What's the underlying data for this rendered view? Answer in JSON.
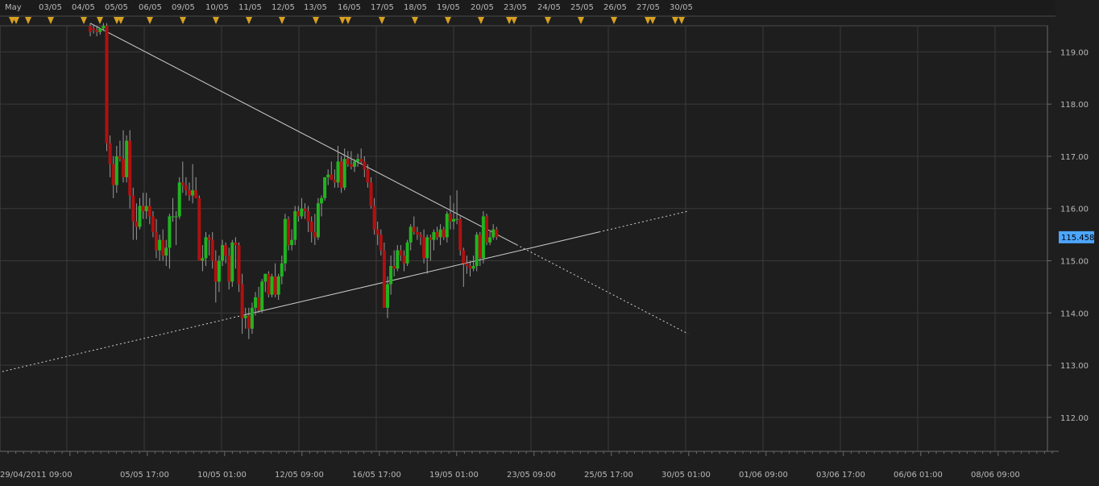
{
  "chart_data": {
    "type": "candlestick",
    "instrument_price_label": "115.458",
    "y_axis": {
      "ylim": [
        111.35,
        119.5
      ],
      "ticks": [
        112,
        113,
        114,
        115,
        116,
        117,
        118,
        119
      ],
      "tick_labels": [
        "112.00",
        "113.00",
        "114.00",
        "115.00",
        "116.00",
        "117.00",
        "118.00",
        "119.00"
      ]
    },
    "x_axis_bottom_labels": [
      "29/04/2011 09:00",
      "05/05 17:00",
      "10/05 01:00",
      "12/05 09:00",
      "16/05 17:00",
      "19/05 01:00",
      "23/05 09:00",
      "25/05 17:00",
      "30/05 01:00",
      "01/06 09:00",
      "03/06 17:00",
      "06/06 01:00",
      "08/06 09:00"
    ],
    "x_axis_top_labels": [
      "May",
      "03/05",
      "04/05",
      "05/05",
      "06/05",
      "09/05",
      "10/05",
      "11/05",
      "12/05",
      "13/05",
      "16/05",
      "17/05",
      "18/05",
      "19/05",
      "20/05",
      "23/05",
      "24/05",
      "25/05",
      "26/05",
      "27/05",
      "30/05"
    ],
    "grid": true,
    "colors": {
      "background": "#1e1e1e",
      "grid": "#3a3a3a",
      "bull": "#1fb51f",
      "bear": "#b01010",
      "wick": "#9a9a9a",
      "trendline": "#d0d0d0",
      "event_marker": "#d8a020",
      "price_tag": "#4da6ff"
    },
    "candles": [
      {
        "o": 119.5,
        "h": 119.55,
        "l": 119.3,
        "c": 119.38
      },
      {
        "o": 119.45,
        "h": 119.5,
        "l": 119.35,
        "c": 119.42
      },
      {
        "o": 119.42,
        "h": 119.5,
        "l": 119.3,
        "c": 119.38
      },
      {
        "o": 119.38,
        "h": 119.45,
        "l": 119.33,
        "c": 119.45
      },
      {
        "o": 119.45,
        "h": 119.55,
        "l": 119.4,
        "c": 119.5
      },
      {
        "o": 119.5,
        "h": 119.55,
        "l": 117.1,
        "c": 117.25
      },
      {
        "o": 117.25,
        "h": 117.4,
        "l": 116.6,
        "c": 116.85
      },
      {
        "o": 116.85,
        "h": 117.0,
        "l": 116.2,
        "c": 116.45
      },
      {
        "o": 116.45,
        "h": 117.2,
        "l": 116.3,
        "c": 117.0
      },
      {
        "o": 117.0,
        "h": 117.3,
        "l": 116.9,
        "c": 116.95
      },
      {
        "o": 116.95,
        "h": 117.5,
        "l": 116.5,
        "c": 116.6
      },
      {
        "o": 116.6,
        "h": 117.4,
        "l": 116.5,
        "c": 117.3
      },
      {
        "o": 117.3,
        "h": 117.5,
        "l": 116.0,
        "c": 116.25
      },
      {
        "o": 116.25,
        "h": 116.4,
        "l": 115.4,
        "c": 115.75
      },
      {
        "o": 115.75,
        "h": 116.1,
        "l": 115.4,
        "c": 115.65
      },
      {
        "o": 115.65,
        "h": 116.2,
        "l": 115.6,
        "c": 116.05
      },
      {
        "o": 116.05,
        "h": 116.3,
        "l": 115.8,
        "c": 115.95
      },
      {
        "o": 115.95,
        "h": 116.3,
        "l": 115.8,
        "c": 116.05
      },
      {
        "o": 116.05,
        "h": 116.2,
        "l": 115.7,
        "c": 115.85
      },
      {
        "o": 115.85,
        "h": 115.95,
        "l": 115.45,
        "c": 115.55
      },
      {
        "o": 115.55,
        "h": 115.8,
        "l": 115.05,
        "c": 115.2
      },
      {
        "o": 115.2,
        "h": 115.5,
        "l": 115.0,
        "c": 115.4
      },
      {
        "o": 115.4,
        "h": 115.6,
        "l": 115.0,
        "c": 115.1
      },
      {
        "o": 115.1,
        "h": 115.4,
        "l": 114.9,
        "c": 115.25
      },
      {
        "o": 115.25,
        "h": 115.9,
        "l": 114.85,
        "c": 115.85
      },
      {
        "o": 115.85,
        "h": 116.2,
        "l": 115.75,
        "c": 115.85
      },
      {
        "o": 115.85,
        "h": 115.95,
        "l": 115.3,
        "c": 115.85
      },
      {
        "o": 115.85,
        "h": 116.6,
        "l": 115.8,
        "c": 116.5
      },
      {
        "o": 116.5,
        "h": 116.9,
        "l": 116.3,
        "c": 116.45
      },
      {
        "o": 116.45,
        "h": 116.6,
        "l": 116.25,
        "c": 116.35
      },
      {
        "o": 116.35,
        "h": 116.5,
        "l": 116.15,
        "c": 116.25
      },
      {
        "o": 116.25,
        "h": 116.85,
        "l": 116.1,
        "c": 116.35
      },
      {
        "o": 116.35,
        "h": 116.6,
        "l": 116.2,
        "c": 116.2
      },
      {
        "o": 116.2,
        "h": 116.25,
        "l": 115.0,
        "c": 115.0
      },
      {
        "o": 115.0,
        "h": 115.3,
        "l": 114.8,
        "c": 115.05
      },
      {
        "o": 115.05,
        "h": 115.55,
        "l": 114.9,
        "c": 115.45
      },
      {
        "o": 115.45,
        "h": 115.5,
        "l": 115.1,
        "c": 115.4
      },
      {
        "o": 115.4,
        "h": 115.55,
        "l": 114.85,
        "c": 115.0
      },
      {
        "o": 115.0,
        "h": 115.2,
        "l": 114.2,
        "c": 114.6
      },
      {
        "o": 114.6,
        "h": 115.1,
        "l": 114.4,
        "c": 115.0
      },
      {
        "o": 115.0,
        "h": 115.4,
        "l": 114.9,
        "c": 115.3
      },
      {
        "o": 115.3,
        "h": 115.35,
        "l": 114.95,
        "c": 115.1
      },
      {
        "o": 115.1,
        "h": 115.25,
        "l": 114.45,
        "c": 114.6
      },
      {
        "o": 114.6,
        "h": 115.4,
        "l": 114.5,
        "c": 115.35
      },
      {
        "o": 115.35,
        "h": 115.45,
        "l": 114.85,
        "c": 115.3
      },
      {
        "o": 115.3,
        "h": 115.35,
        "l": 114.4,
        "c": 114.55
      },
      {
        "o": 114.55,
        "h": 114.75,
        "l": 113.6,
        "c": 113.9
      },
      {
        "o": 113.9,
        "h": 114.1,
        "l": 113.7,
        "c": 113.95
      },
      {
        "o": 113.95,
        "h": 114.1,
        "l": 113.5,
        "c": 113.7
      },
      {
        "o": 113.7,
        "h": 114.2,
        "l": 113.6,
        "c": 114.1
      },
      {
        "o": 114.1,
        "h": 114.4,
        "l": 113.95,
        "c": 114.3
      },
      {
        "o": 114.3,
        "h": 114.5,
        "l": 114.0,
        "c": 114.05
      },
      {
        "o": 114.05,
        "h": 114.65,
        "l": 114.0,
        "c": 114.6
      },
      {
        "o": 114.6,
        "h": 114.75,
        "l": 114.4,
        "c": 114.75
      },
      {
        "o": 114.75,
        "h": 114.8,
        "l": 114.3,
        "c": 114.35
      },
      {
        "o": 114.35,
        "h": 114.75,
        "l": 114.3,
        "c": 114.7
      },
      {
        "o": 114.7,
        "h": 114.95,
        "l": 114.3,
        "c": 114.35
      },
      {
        "o": 114.35,
        "h": 114.75,
        "l": 114.25,
        "c": 114.7
      },
      {
        "o": 114.7,
        "h": 115.1,
        "l": 114.55,
        "c": 114.95
      },
      {
        "o": 114.95,
        "h": 115.9,
        "l": 114.8,
        "c": 115.8
      },
      {
        "o": 115.8,
        "h": 115.85,
        "l": 115.2,
        "c": 115.3
      },
      {
        "o": 115.3,
        "h": 115.6,
        "l": 115.2,
        "c": 115.4
      },
      {
        "o": 115.4,
        "h": 116.05,
        "l": 115.3,
        "c": 115.95
      },
      {
        "o": 115.95,
        "h": 116.05,
        "l": 115.75,
        "c": 115.85
      },
      {
        "o": 115.85,
        "h": 116.2,
        "l": 115.8,
        "c": 116.0
      },
      {
        "o": 116.0,
        "h": 116.1,
        "l": 115.8,
        "c": 115.95
      },
      {
        "o": 115.95,
        "h": 116.05,
        "l": 115.55,
        "c": 115.75
      },
      {
        "o": 115.75,
        "h": 115.85,
        "l": 115.35,
        "c": 115.55
      },
      {
        "o": 115.55,
        "h": 115.9,
        "l": 115.3,
        "c": 115.45
      },
      {
        "o": 115.45,
        "h": 116.2,
        "l": 115.4,
        "c": 116.1
      },
      {
        "o": 116.1,
        "h": 116.25,
        "l": 115.85,
        "c": 116.2
      },
      {
        "o": 116.2,
        "h": 116.45,
        "l": 116.15,
        "c": 116.6
      },
      {
        "o": 116.6,
        "h": 116.75,
        "l": 116.45,
        "c": 116.65
      },
      {
        "o": 116.65,
        "h": 116.9,
        "l": 116.6,
        "c": 116.55
      },
      {
        "o": 116.55,
        "h": 116.75,
        "l": 116.4,
        "c": 116.5
      },
      {
        "o": 116.5,
        "h": 117.2,
        "l": 116.4,
        "c": 116.9
      },
      {
        "o": 116.9,
        "h": 117.0,
        "l": 116.3,
        "c": 116.4
      },
      {
        "o": 116.4,
        "h": 117.15,
        "l": 116.35,
        "c": 116.95
      },
      {
        "o": 116.95,
        "h": 117.1,
        "l": 116.8,
        "c": 116.85
      },
      {
        "o": 116.85,
        "h": 117.1,
        "l": 116.75,
        "c": 116.8
      },
      {
        "o": 116.8,
        "h": 116.95,
        "l": 116.7,
        "c": 116.9
      },
      {
        "o": 116.9,
        "h": 117.05,
        "l": 116.8,
        "c": 116.95
      },
      {
        "o": 116.95,
        "h": 117.15,
        "l": 116.85,
        "c": 116.9
      },
      {
        "o": 116.9,
        "h": 117.0,
        "l": 116.6,
        "c": 116.75
      },
      {
        "o": 116.75,
        "h": 116.85,
        "l": 116.4,
        "c": 116.5
      },
      {
        "o": 116.5,
        "h": 116.6,
        "l": 116.0,
        "c": 116.05
      },
      {
        "o": 116.05,
        "h": 116.2,
        "l": 115.5,
        "c": 115.6
      },
      {
        "o": 115.6,
        "h": 115.75,
        "l": 115.3,
        "c": 115.5
      },
      {
        "o": 115.5,
        "h": 115.6,
        "l": 115.1,
        "c": 115.2
      },
      {
        "o": 115.2,
        "h": 115.35,
        "l": 114.1,
        "c": 114.1
      },
      {
        "o": 114.1,
        "h": 114.7,
        "l": 113.9,
        "c": 114.55
      },
      {
        "o": 114.55,
        "h": 115.1,
        "l": 114.35,
        "c": 114.9
      },
      {
        "o": 114.9,
        "h": 115.2,
        "l": 114.7,
        "c": 114.85
      },
      {
        "o": 114.85,
        "h": 115.3,
        "l": 114.8,
        "c": 115.2
      },
      {
        "o": 115.2,
        "h": 115.3,
        "l": 115.0,
        "c": 115.1
      },
      {
        "o": 115.1,
        "h": 115.2,
        "l": 114.8,
        "c": 114.95
      },
      {
        "o": 114.95,
        "h": 115.4,
        "l": 114.9,
        "c": 115.35
      },
      {
        "o": 115.35,
        "h": 115.7,
        "l": 115.2,
        "c": 115.65
      },
      {
        "o": 115.65,
        "h": 115.85,
        "l": 115.5,
        "c": 115.55
      },
      {
        "o": 115.55,
        "h": 115.65,
        "l": 115.4,
        "c": 115.5
      },
      {
        "o": 115.5,
        "h": 115.55,
        "l": 115.3,
        "c": 115.45
      },
      {
        "o": 115.45,
        "h": 115.6,
        "l": 114.95,
        "c": 115.05
      },
      {
        "o": 115.05,
        "h": 115.5,
        "l": 114.75,
        "c": 115.45
      },
      {
        "o": 115.45,
        "h": 115.5,
        "l": 115.0,
        "c": 115.4
      },
      {
        "o": 115.4,
        "h": 115.6,
        "l": 115.2,
        "c": 115.55
      },
      {
        "o": 115.55,
        "h": 115.65,
        "l": 115.4,
        "c": 115.45
      },
      {
        "o": 115.45,
        "h": 115.7,
        "l": 115.3,
        "c": 115.6
      },
      {
        "o": 115.6,
        "h": 115.65,
        "l": 115.4,
        "c": 115.45
      },
      {
        "o": 115.45,
        "h": 115.95,
        "l": 115.35,
        "c": 115.9
      },
      {
        "o": 115.9,
        "h": 116.25,
        "l": 115.6,
        "c": 115.75
      },
      {
        "o": 115.75,
        "h": 116.1,
        "l": 115.6,
        "c": 115.8
      },
      {
        "o": 115.8,
        "h": 116.35,
        "l": 115.7,
        "c": 115.8
      },
      {
        "o": 115.8,
        "h": 115.85,
        "l": 115.1,
        "c": 115.2
      },
      {
        "o": 115.2,
        "h": 115.25,
        "l": 114.5,
        "c": 114.95
      },
      {
        "o": 114.95,
        "h": 115.1,
        "l": 114.75,
        "c": 114.9
      },
      {
        "o": 114.9,
        "h": 115.0,
        "l": 114.7,
        "c": 114.85
      },
      {
        "o": 114.85,
        "h": 115.1,
        "l": 114.8,
        "c": 114.9
      },
      {
        "o": 114.9,
        "h": 115.55,
        "l": 114.8,
        "c": 115.5
      },
      {
        "o": 115.5,
        "h": 115.55,
        "l": 114.9,
        "c": 115.05
      },
      {
        "o": 115.05,
        "h": 115.95,
        "l": 114.95,
        "c": 115.85
      },
      {
        "o": 115.85,
        "h": 115.9,
        "l": 115.3,
        "c": 115.35
      },
      {
        "o": 115.35,
        "h": 115.55,
        "l": 115.3,
        "c": 115.45
      },
      {
        "o": 115.45,
        "h": 115.7,
        "l": 115.4,
        "c": 115.6
      },
      {
        "o": 115.6,
        "h": 115.65,
        "l": 115.4,
        "c": 115.45
      }
    ],
    "trendlines": [
      {
        "name": "upper",
        "from": {
          "candle": 0,
          "y": 119.55
        },
        "to": {
          "candle": 181,
          "y": 113.6
        },
        "dashed_before_candle": 0,
        "dashed_after_candle": 129
      },
      {
        "name": "lower",
        "from": {
          "candle": -67,
          "y": 112.28
        },
        "to": {
          "candle": 181,
          "y": 115.95
        },
        "dashed_before_candle": 46,
        "dashed_after_candle": 154
      }
    ],
    "event_marker_count": 29
  }
}
